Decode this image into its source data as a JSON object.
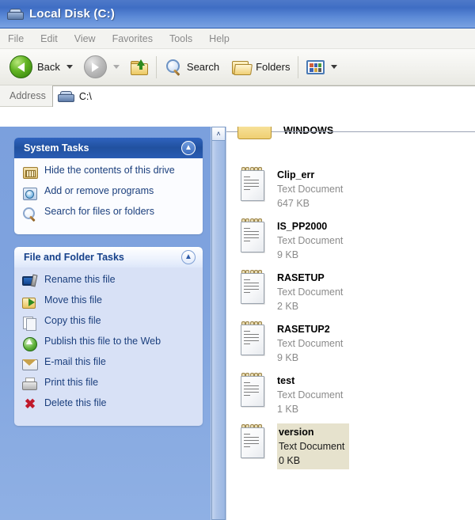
{
  "window": {
    "title": "Local Disk (C:)",
    "title_icon": "hard-drive-icon"
  },
  "menubar": {
    "items": [
      {
        "label": "File"
      },
      {
        "label": "Edit"
      },
      {
        "label": "View"
      },
      {
        "label": "Favorites"
      },
      {
        "label": "Tools"
      },
      {
        "label": "Help"
      }
    ]
  },
  "toolbar": {
    "back_label": "Back",
    "search_label": "Search",
    "folders_label": "Folders",
    "back_icon": "back-arrow-icon",
    "forward_icon": "forward-arrow-icon",
    "up_icon": "up-folder-icon",
    "search_icon": "magnifier-icon",
    "folders_icon": "folder-icon",
    "views_icon": "views-grid-icon"
  },
  "address": {
    "label": "Address",
    "value": "C:\\",
    "icon": "hard-drive-icon"
  },
  "sidebar": {
    "panels": [
      {
        "title": "System Tasks",
        "style": "blue",
        "collapse_icon": "chevron-up-icon",
        "items": [
          {
            "label": "Hide the contents of this drive",
            "icon": "hide-contents-icon"
          },
          {
            "label": "Add or remove programs",
            "icon": "add-remove-programs-icon"
          },
          {
            "label": "Search for files or folders",
            "icon": "search-icon"
          }
        ]
      },
      {
        "title": "File and Folder Tasks",
        "style": "light",
        "collapse_icon": "chevron-up-icon",
        "items": [
          {
            "label": "Rename this file",
            "icon": "rename-icon"
          },
          {
            "label": "Move this file",
            "icon": "move-icon"
          },
          {
            "label": "Copy this file",
            "icon": "copy-icon"
          },
          {
            "label": "Publish this file to the Web",
            "icon": "publish-web-icon"
          },
          {
            "label": "E-mail this file",
            "icon": "email-icon"
          },
          {
            "label": "Print this file",
            "icon": "print-icon"
          },
          {
            "label": "Delete this file",
            "icon": "delete-x-icon"
          }
        ]
      }
    ]
  },
  "scrollbar": {
    "up_arrow": "˄",
    "up_icon": "scroll-up-arrow-icon"
  },
  "files": {
    "clipped_top": {
      "name": "WINDOWS",
      "icon": "folder-icon"
    },
    "items": [
      {
        "name": "Clip_err",
        "type": "Text Document",
        "size": "647 KB",
        "icon": "text-document-icon",
        "selected": false
      },
      {
        "name": "IS_PP2000",
        "type": "Text Document",
        "size": "9 KB",
        "icon": "text-document-icon",
        "selected": false
      },
      {
        "name": "RASETUP",
        "type": "Text Document",
        "size": "2 KB",
        "icon": "text-document-icon",
        "selected": false
      },
      {
        "name": "RASETUP2",
        "type": "Text Document",
        "size": "9 KB",
        "icon": "text-document-icon",
        "selected": false
      },
      {
        "name": "test",
        "type": "Text Document",
        "size": "1 KB",
        "icon": "text-document-icon",
        "selected": false
      },
      {
        "name": "version",
        "type": "Text Document",
        "size": "0 KB",
        "icon": "text-document-icon",
        "selected": true
      }
    ]
  },
  "colors": {
    "titlebar_blue": "#3f6ec4",
    "sidebar_blue": "#7ba0dd",
    "panel_header_blue": "#21519f",
    "panel_body_lavender": "#d8e1f6",
    "selection_beige": "#e6e2cd",
    "task_link_text": "#1b3f7d"
  }
}
